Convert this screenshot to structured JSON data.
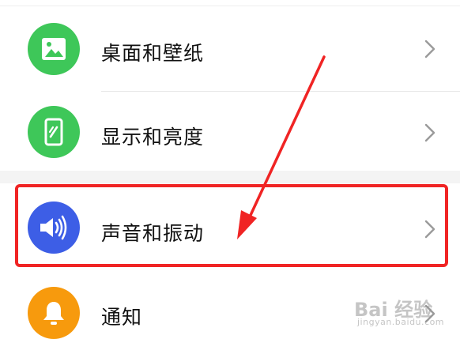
{
  "settings": {
    "items": [
      {
        "label": "桌面和壁纸",
        "icon": "wallpaper-icon",
        "icon_color": "#3ec759"
      },
      {
        "label": "显示和亮度",
        "icon": "display-brightness-icon",
        "icon_color": "#3ec759"
      },
      {
        "label": "声音和振动",
        "icon": "sound-vibration-icon",
        "icon_color": "#3d5ee6"
      },
      {
        "label": "通知",
        "icon": "notification-bell-icon",
        "icon_color": "#f79a0d"
      }
    ]
  },
  "annotation": {
    "highlight_color": "#f02424",
    "arrow_color": "#f02424"
  },
  "watermark": {
    "main": "Bai 经验",
    "sub": "jingyan.baidu.com"
  }
}
